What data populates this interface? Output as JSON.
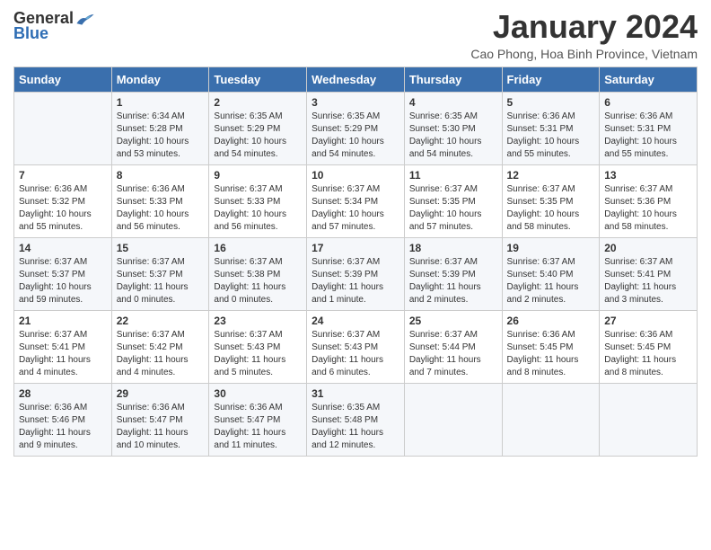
{
  "logo": {
    "general": "General",
    "blue": "Blue"
  },
  "title": "January 2024",
  "subtitle": "Cao Phong, Hoa Binh Province, Vietnam",
  "days_of_week": [
    "Sunday",
    "Monday",
    "Tuesday",
    "Wednesday",
    "Thursday",
    "Friday",
    "Saturday"
  ],
  "weeks": [
    [
      {
        "day": "",
        "info": ""
      },
      {
        "day": "1",
        "info": "Sunrise: 6:34 AM\nSunset: 5:28 PM\nDaylight: 10 hours\nand 53 minutes."
      },
      {
        "day": "2",
        "info": "Sunrise: 6:35 AM\nSunset: 5:29 PM\nDaylight: 10 hours\nand 54 minutes."
      },
      {
        "day": "3",
        "info": "Sunrise: 6:35 AM\nSunset: 5:29 PM\nDaylight: 10 hours\nand 54 minutes."
      },
      {
        "day": "4",
        "info": "Sunrise: 6:35 AM\nSunset: 5:30 PM\nDaylight: 10 hours\nand 54 minutes."
      },
      {
        "day": "5",
        "info": "Sunrise: 6:36 AM\nSunset: 5:31 PM\nDaylight: 10 hours\nand 55 minutes."
      },
      {
        "day": "6",
        "info": "Sunrise: 6:36 AM\nSunset: 5:31 PM\nDaylight: 10 hours\nand 55 minutes."
      }
    ],
    [
      {
        "day": "7",
        "info": "Sunrise: 6:36 AM\nSunset: 5:32 PM\nDaylight: 10 hours\nand 55 minutes."
      },
      {
        "day": "8",
        "info": "Sunrise: 6:36 AM\nSunset: 5:33 PM\nDaylight: 10 hours\nand 56 minutes."
      },
      {
        "day": "9",
        "info": "Sunrise: 6:37 AM\nSunset: 5:33 PM\nDaylight: 10 hours\nand 56 minutes."
      },
      {
        "day": "10",
        "info": "Sunrise: 6:37 AM\nSunset: 5:34 PM\nDaylight: 10 hours\nand 57 minutes."
      },
      {
        "day": "11",
        "info": "Sunrise: 6:37 AM\nSunset: 5:35 PM\nDaylight: 10 hours\nand 57 minutes."
      },
      {
        "day": "12",
        "info": "Sunrise: 6:37 AM\nSunset: 5:35 PM\nDaylight: 10 hours\nand 58 minutes."
      },
      {
        "day": "13",
        "info": "Sunrise: 6:37 AM\nSunset: 5:36 PM\nDaylight: 10 hours\nand 58 minutes."
      }
    ],
    [
      {
        "day": "14",
        "info": "Sunrise: 6:37 AM\nSunset: 5:37 PM\nDaylight: 10 hours\nand 59 minutes."
      },
      {
        "day": "15",
        "info": "Sunrise: 6:37 AM\nSunset: 5:37 PM\nDaylight: 11 hours\nand 0 minutes."
      },
      {
        "day": "16",
        "info": "Sunrise: 6:37 AM\nSunset: 5:38 PM\nDaylight: 11 hours\nand 0 minutes."
      },
      {
        "day": "17",
        "info": "Sunrise: 6:37 AM\nSunset: 5:39 PM\nDaylight: 11 hours\nand 1 minute."
      },
      {
        "day": "18",
        "info": "Sunrise: 6:37 AM\nSunset: 5:39 PM\nDaylight: 11 hours\nand 2 minutes."
      },
      {
        "day": "19",
        "info": "Sunrise: 6:37 AM\nSunset: 5:40 PM\nDaylight: 11 hours\nand 2 minutes."
      },
      {
        "day": "20",
        "info": "Sunrise: 6:37 AM\nSunset: 5:41 PM\nDaylight: 11 hours\nand 3 minutes."
      }
    ],
    [
      {
        "day": "21",
        "info": "Sunrise: 6:37 AM\nSunset: 5:41 PM\nDaylight: 11 hours\nand 4 minutes."
      },
      {
        "day": "22",
        "info": "Sunrise: 6:37 AM\nSunset: 5:42 PM\nDaylight: 11 hours\nand 4 minutes."
      },
      {
        "day": "23",
        "info": "Sunrise: 6:37 AM\nSunset: 5:43 PM\nDaylight: 11 hours\nand 5 minutes."
      },
      {
        "day": "24",
        "info": "Sunrise: 6:37 AM\nSunset: 5:43 PM\nDaylight: 11 hours\nand 6 minutes."
      },
      {
        "day": "25",
        "info": "Sunrise: 6:37 AM\nSunset: 5:44 PM\nDaylight: 11 hours\nand 7 minutes."
      },
      {
        "day": "26",
        "info": "Sunrise: 6:36 AM\nSunset: 5:45 PM\nDaylight: 11 hours\nand 8 minutes."
      },
      {
        "day": "27",
        "info": "Sunrise: 6:36 AM\nSunset: 5:45 PM\nDaylight: 11 hours\nand 8 minutes."
      }
    ],
    [
      {
        "day": "28",
        "info": "Sunrise: 6:36 AM\nSunset: 5:46 PM\nDaylight: 11 hours\nand 9 minutes."
      },
      {
        "day": "29",
        "info": "Sunrise: 6:36 AM\nSunset: 5:47 PM\nDaylight: 11 hours\nand 10 minutes."
      },
      {
        "day": "30",
        "info": "Sunrise: 6:36 AM\nSunset: 5:47 PM\nDaylight: 11 hours\nand 11 minutes."
      },
      {
        "day": "31",
        "info": "Sunrise: 6:35 AM\nSunset: 5:48 PM\nDaylight: 11 hours\nand 12 minutes."
      },
      {
        "day": "",
        "info": ""
      },
      {
        "day": "",
        "info": ""
      },
      {
        "day": "",
        "info": ""
      }
    ]
  ]
}
